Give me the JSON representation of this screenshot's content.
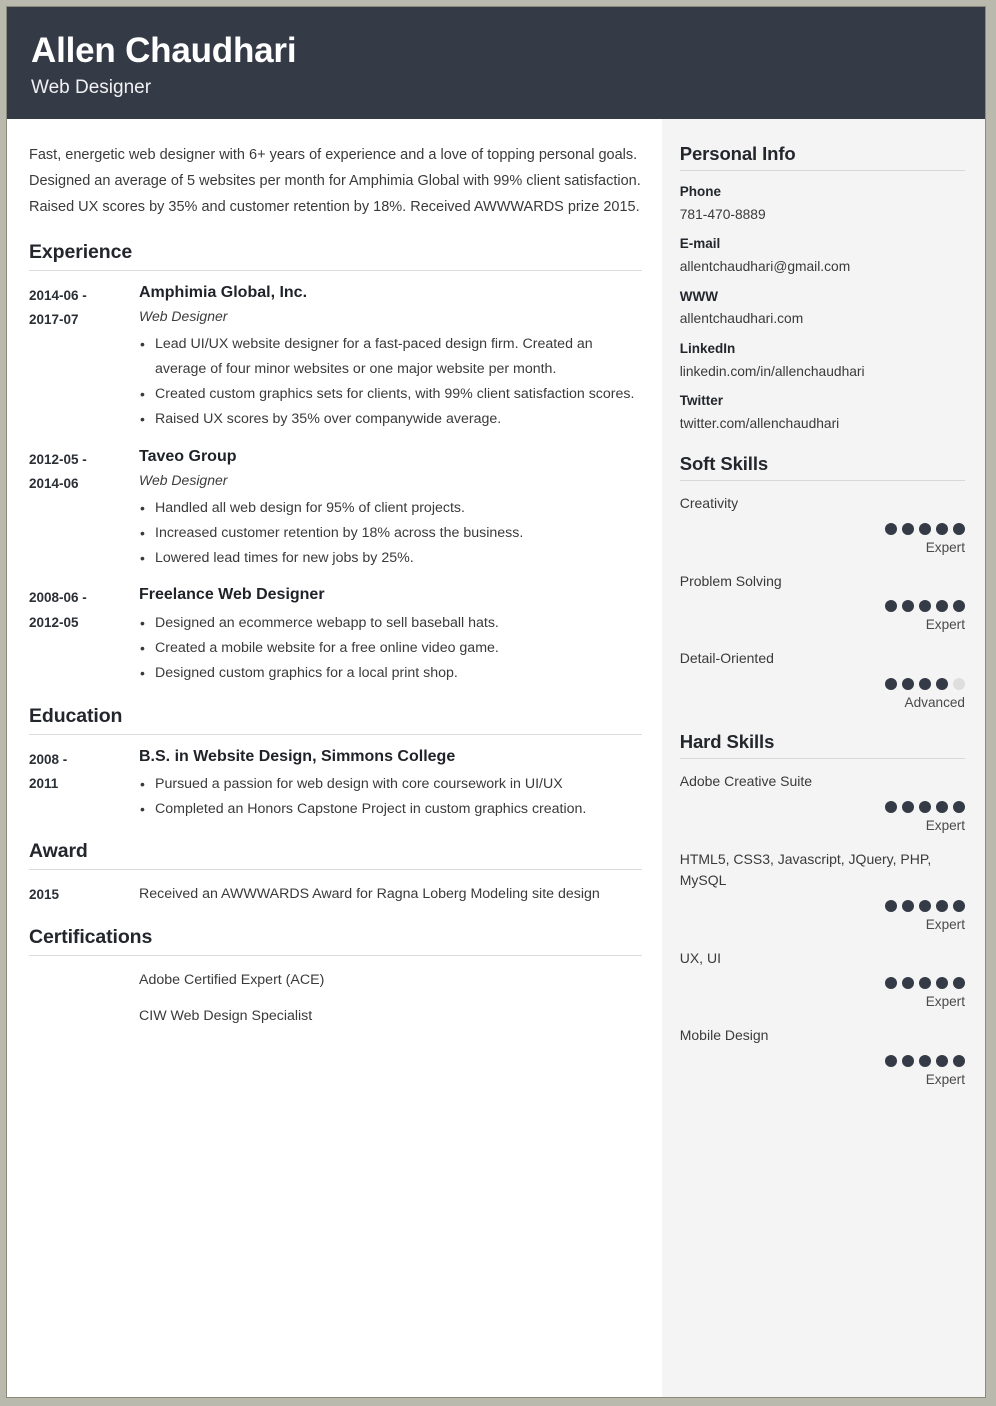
{
  "header": {
    "name": "Allen Chaudhari",
    "job_title": "Web Designer",
    "background_color": "#343a46"
  },
  "summary": {
    "line1": "Fast, energetic web designer with 6+ years of experience and a love of topping personal goals.",
    "line2": "Designed an average of 5 websites per month for Amphimia Global with 99% client satisfaction.",
    "line3": "Raised UX scores by 35% and customer retention by 18%. Received AWWWARDS prize 2015."
  },
  "experience": {
    "heading": "Experience",
    "entries": [
      {
        "date_start": "2014-06 -",
        "date_end": "2017-07",
        "organization": "Amphimia Global, Inc.",
        "role": "Web Designer",
        "bullets": [
          "Lead UI/UX website designer for a fast-paced design firm. Created an average of four minor websites or one major website per month.",
          "Created custom graphics sets for clients, with 99% client satisfaction scores.",
          "Raised UX scores by 35% over companywide average."
        ]
      },
      {
        "date_start": "2012-05 -",
        "date_end": "2014-06",
        "organization": "Taveo Group",
        "role": "Web Designer",
        "bullets": [
          "Handled all web design for 95% of client projects.",
          "Increased customer retention by 18% across the business.",
          "Lowered lead times for new jobs by 25%."
        ]
      },
      {
        "date_start": "2008-06 -",
        "date_end": "2012-05",
        "organization": "Freelance Web Designer",
        "role": "",
        "bullets": [
          "Designed an ecommerce webapp to sell baseball hats.",
          "Created a mobile website for a free online video game.",
          "Designed custom graphics for a local print shop."
        ]
      }
    ]
  },
  "education": {
    "heading": "Education",
    "entries": [
      {
        "date_start": "2008 -",
        "date_end": "2011",
        "organization": "B.S. in Website Design, Simmons College",
        "bullets": [
          "Pursued a passion for web design with core coursework in UI/UX",
          "Completed an Honors Capstone Project in custom graphics creation."
        ]
      }
    ]
  },
  "award": {
    "heading": "Award",
    "entries": [
      {
        "date": "2015",
        "text": "Received an AWWWARDS Award for Ragna Loberg Modeling site design"
      }
    ]
  },
  "certifications": {
    "heading": "Certifications",
    "items": [
      "Adobe Certified Expert (ACE)",
      "CIW Web Design Specialist"
    ]
  },
  "sidebar": {
    "personal_info": {
      "heading": "Personal Info",
      "items": [
        {
          "label": "Phone",
          "value": "781-470-8889"
        },
        {
          "label": "E-mail",
          "value": "allentchaudhari@gmail.com"
        },
        {
          "label": "WWW",
          "value": "allentchaudhari.com"
        },
        {
          "label": "LinkedIn",
          "value": "linkedin.com/in/allenchaudhari"
        },
        {
          "label": "Twitter",
          "value": "twitter.com/allenchaudhari"
        }
      ]
    },
    "soft_skills": {
      "heading": "Soft Skills",
      "max_dots": 5,
      "items": [
        {
          "name": "Creativity",
          "filled": 5,
          "level": "Expert"
        },
        {
          "name": "Problem Solving",
          "filled": 5,
          "level": "Expert"
        },
        {
          "name": "Detail-Oriented",
          "filled": 4,
          "level": "Advanced"
        }
      ]
    },
    "hard_skills": {
      "heading": "Hard Skills",
      "max_dots": 5,
      "items": [
        {
          "name": "Adobe Creative Suite",
          "filled": 5,
          "level": "Expert"
        },
        {
          "name": "HTML5, CSS3, Javascript, JQuery, PHP, MySQL",
          "filled": 5,
          "level": "Expert"
        },
        {
          "name": "UX, UI",
          "filled": 5,
          "level": "Expert"
        },
        {
          "name": "Mobile Design",
          "filled": 5,
          "level": "Expert"
        }
      ]
    },
    "dot_filled_color": "#343a46",
    "dot_empty_color": "#dedede",
    "background_color": "#f4f4f4"
  }
}
